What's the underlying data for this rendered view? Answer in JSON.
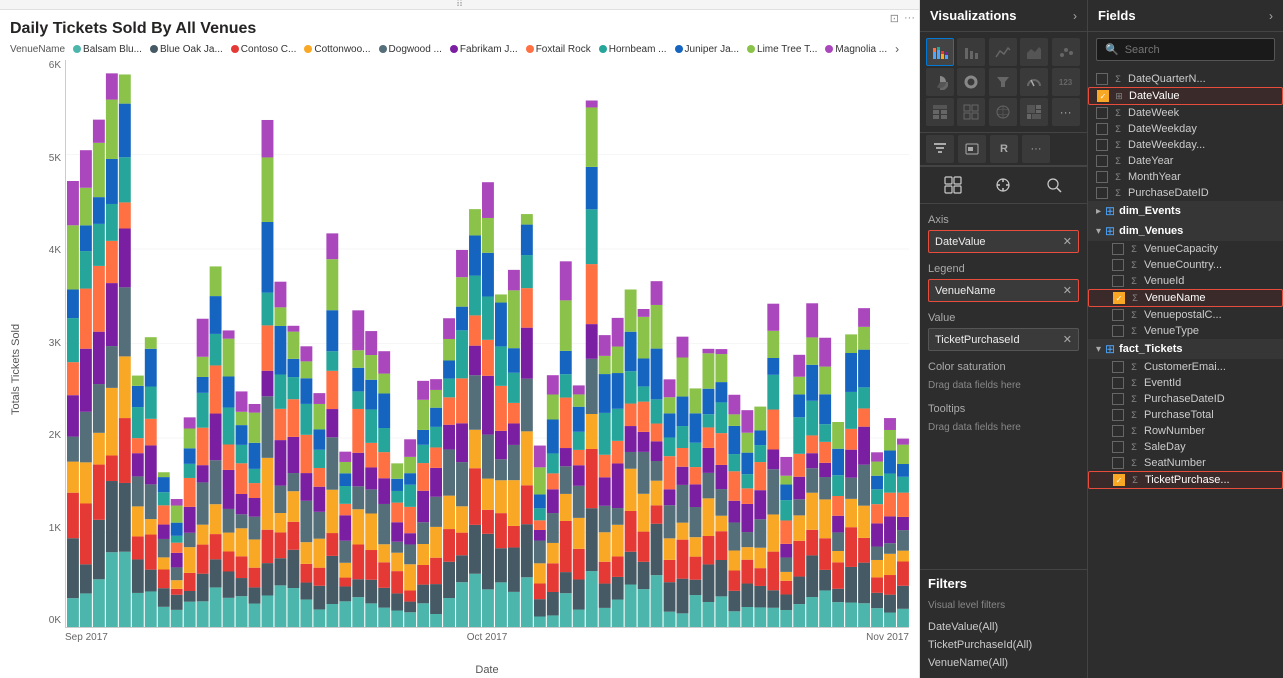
{
  "chart": {
    "title": "Daily Tickets Sold By All Venues",
    "yAxisLabel": "Totals Tickets Sold",
    "xAxisLabel": "Date",
    "yTicks": [
      "0K",
      "1K",
      "2K",
      "3K",
      "4K",
      "5K",
      "6K"
    ],
    "xTicks": [
      "Sep 2017",
      "Oct 2017",
      "Nov 2017"
    ],
    "legendTitle": "VenueName",
    "legendItems": [
      {
        "label": "Balsam Blu...",
        "color": "#4db6ac"
      },
      {
        "label": "Blue Oak Ja...",
        "color": "#455a64"
      },
      {
        "label": "Contoso C...",
        "color": "#e53935"
      },
      {
        "label": "Cottonwoo...",
        "color": "#f9a825"
      },
      {
        "label": "Dogwood ...",
        "color": "#546e7a"
      },
      {
        "label": "Fabrikam J...",
        "color": "#7b1fa2"
      },
      {
        "label": "Foxtail Rock",
        "color": "#ff7043"
      },
      {
        "label": "Hornbeam ...",
        "color": "#26a69a"
      },
      {
        "label": "Juniper Ja...",
        "color": "#1565c0"
      },
      {
        "label": "Lime Tree T...",
        "color": "#8bc34a"
      },
      {
        "label": "Magnolia ...",
        "color": "#ab47bc"
      }
    ]
  },
  "visualizations": {
    "title": "Visualizations",
    "expandLabel": "›",
    "icons": [
      {
        "name": "stacked-bar",
        "symbol": "▦",
        "active": true
      },
      {
        "name": "bar-chart",
        "symbol": "▮▮"
      },
      {
        "name": "line-chart",
        "symbol": "╱"
      },
      {
        "name": "area-chart",
        "symbol": "◣"
      },
      {
        "name": "scatter",
        "symbol": "⁙"
      },
      {
        "name": "pie",
        "symbol": "◑"
      },
      {
        "name": "donut",
        "symbol": "◎"
      },
      {
        "name": "funnel",
        "symbol": "⏣"
      },
      {
        "name": "gauge",
        "symbol": "⌀"
      },
      {
        "name": "kpi",
        "symbol": "123"
      },
      {
        "name": "table",
        "symbol": "⊞"
      },
      {
        "name": "matrix",
        "symbol": "⊡"
      },
      {
        "name": "map",
        "symbol": "🌐"
      },
      {
        "name": "treemap",
        "symbol": "▦"
      },
      {
        "name": "more",
        "symbol": "..."
      },
      {
        "name": "filter-viz",
        "symbol": "⊟"
      },
      {
        "name": "slicer",
        "symbol": "⊟"
      },
      {
        "name": "r-visual",
        "symbol": "R"
      },
      {
        "name": "more-2",
        "symbol": "···"
      }
    ],
    "controls": [
      {
        "name": "fields-ctrl",
        "symbol": "⊞"
      },
      {
        "name": "format-ctrl",
        "symbol": "🖌"
      },
      {
        "name": "analytics-ctrl",
        "symbol": "🔍"
      }
    ],
    "axis": {
      "label": "Axis",
      "value": "DateValue",
      "highlighted": true
    },
    "legend": {
      "label": "Legend",
      "value": "VenueName",
      "highlighted": true
    },
    "value": {
      "label": "Value",
      "value": "TicketPurchaseId",
      "highlighted": false
    },
    "colorSaturation": {
      "label": "Color saturation",
      "placeholder": "Drag data fields here"
    },
    "tooltips": {
      "label": "Tooltips",
      "placeholder": "Drag data fields here"
    }
  },
  "filters": {
    "title": "Filters",
    "visualLevelLabel": "Visual level filters",
    "items": [
      {
        "label": "DateValue(All)"
      },
      {
        "label": "TicketPurchaseId(All)"
      },
      {
        "label": "VenueName(All)"
      }
    ]
  },
  "fields": {
    "title": "Fields",
    "collapseLabel": "›",
    "search": {
      "placeholder": "Search",
      "icon": "🔍"
    },
    "tables": [
      {
        "name": "DateQuarterN...",
        "icon": "Σ",
        "isTable": false,
        "checked": false,
        "highlighted": false
      },
      {
        "name": "DateValue",
        "icon": "⊞",
        "isTable": false,
        "checked": true,
        "highlighted": true
      },
      {
        "name": "DateWeek",
        "icon": "Σ",
        "isTable": false,
        "checked": false,
        "highlighted": false
      },
      {
        "name": "DateWeekday",
        "icon": "Σ",
        "isTable": false,
        "checked": false,
        "highlighted": false
      },
      {
        "name": "DateWeekday...",
        "icon": "Σ",
        "isTable": false,
        "checked": false,
        "highlighted": false
      },
      {
        "name": "DateYear",
        "icon": "Σ",
        "isTable": false,
        "checked": false,
        "highlighted": false
      },
      {
        "name": "MonthYear",
        "icon": "Σ",
        "isTable": false,
        "checked": false,
        "highlighted": false
      },
      {
        "name": "PurchaseDateID",
        "icon": "Σ",
        "isTable": false,
        "checked": false,
        "highlighted": false
      },
      {
        "name": "dim_Events",
        "isTableHeader": true,
        "expanded": false
      },
      {
        "name": "dim_Venues",
        "isTableHeader": true,
        "expanded": true
      },
      {
        "name": "VenueCapacity",
        "icon": "Σ",
        "isTable": false,
        "checked": false,
        "highlighted": false,
        "indent": true
      },
      {
        "name": "VenueCountry...",
        "icon": "Σ",
        "isTable": false,
        "checked": false,
        "highlighted": false,
        "indent": true
      },
      {
        "name": "VenueId",
        "icon": "Σ",
        "isTable": false,
        "checked": false,
        "highlighted": false,
        "indent": true
      },
      {
        "name": "VenueName",
        "icon": "Σ",
        "isTable": false,
        "checked": true,
        "highlighted": true,
        "indent": true
      },
      {
        "name": "VenuepostalC...",
        "icon": "Σ",
        "isTable": false,
        "checked": false,
        "highlighted": false,
        "indent": true
      },
      {
        "name": "VenueType",
        "icon": "Σ",
        "isTable": false,
        "checked": false,
        "highlighted": false,
        "indent": true
      },
      {
        "name": "fact_Tickets",
        "isTableHeader": true,
        "expanded": true
      },
      {
        "name": "CustomerEmai...",
        "icon": "Σ",
        "isTable": false,
        "checked": false,
        "highlighted": false,
        "indent": true
      },
      {
        "name": "EventId",
        "icon": "Σ",
        "isTable": false,
        "checked": false,
        "highlighted": false,
        "indent": true
      },
      {
        "name": "PurchaseDateID",
        "icon": "Σ",
        "isTable": false,
        "checked": false,
        "highlighted": false,
        "indent": true
      },
      {
        "name": "PurchaseTotal",
        "icon": "Σ",
        "isTable": false,
        "checked": false,
        "highlighted": false,
        "indent": true
      },
      {
        "name": "RowNumber",
        "icon": "Σ",
        "isTable": false,
        "checked": false,
        "highlighted": false,
        "indent": true
      },
      {
        "name": "SaleDay",
        "icon": "Σ",
        "isTable": false,
        "checked": false,
        "highlighted": false,
        "indent": true
      },
      {
        "name": "SeatNumber",
        "icon": "Σ",
        "isTable": false,
        "checked": false,
        "highlighted": false,
        "indent": true
      },
      {
        "name": "TicketPurchase...",
        "icon": "Σ",
        "isTable": false,
        "checked": true,
        "highlighted": true,
        "indent": true
      }
    ]
  }
}
